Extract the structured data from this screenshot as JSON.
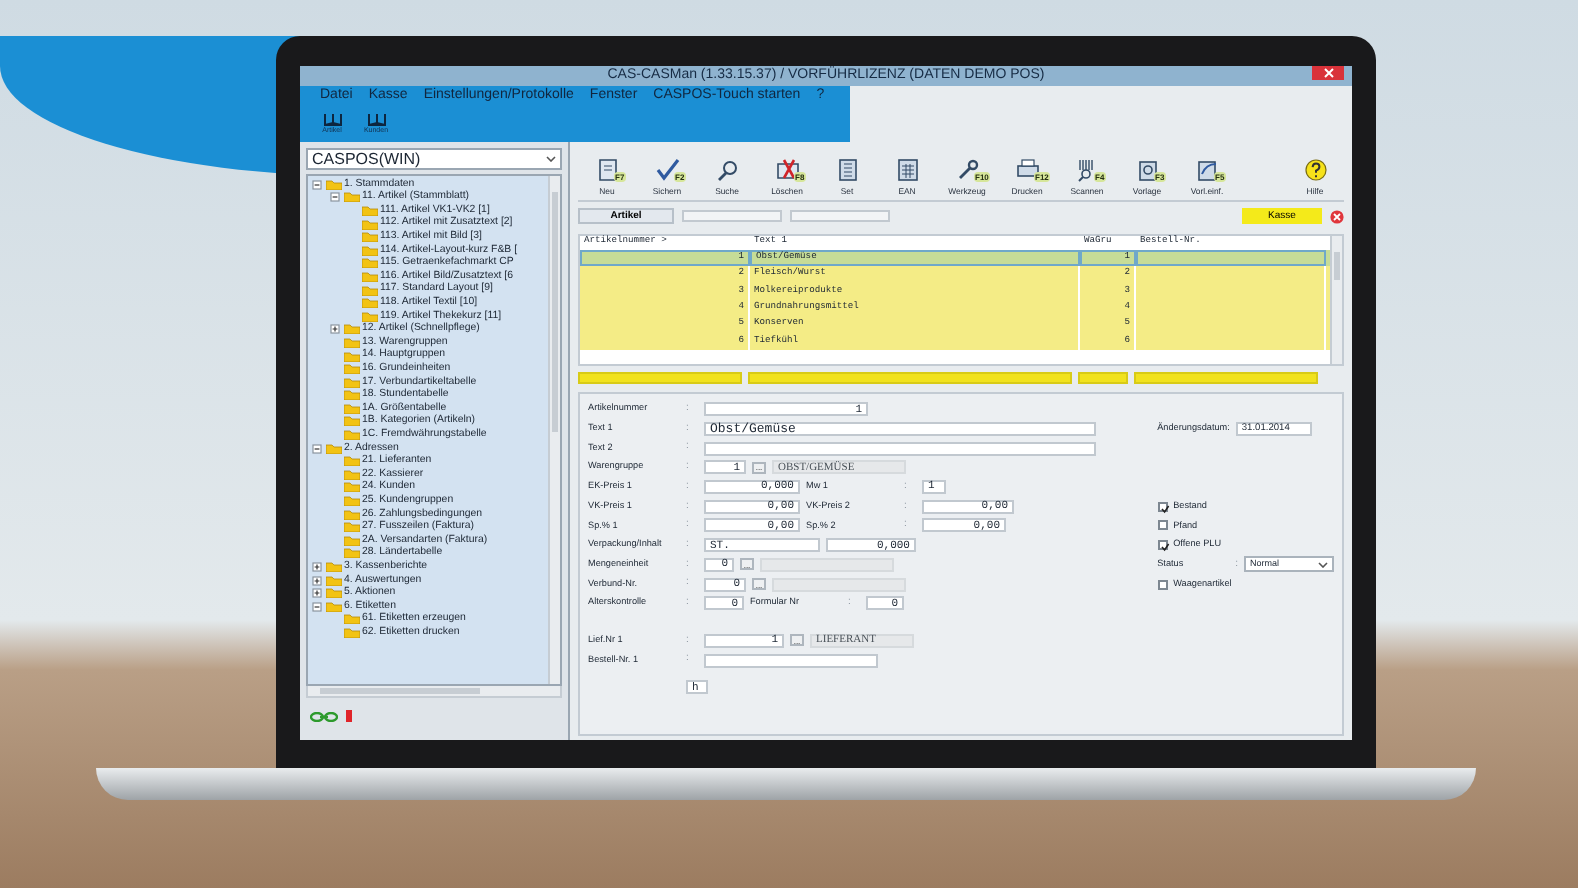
{
  "window": {
    "title": "CAS-CASMan (1.33.15.37) / VORFÜHRLIZENZ (DATEN DEMO POS)"
  },
  "menu": [
    "Datei",
    "Kasse",
    "Einstellungen/Protokolle",
    "Fenster",
    "CASPOS-Touch starten",
    "?"
  ],
  "quickbar": [
    {
      "label": "Artikel"
    },
    {
      "label": "Kunden"
    }
  ],
  "sidebar": {
    "selector": {
      "value": "CASPOS(WIN)"
    },
    "tree": [
      {
        "label": "1. Stammdaten",
        "expanded": true,
        "children": [
          {
            "label": "11. Artikel (Stammblatt)",
            "expanded": true,
            "children": [
              {
                "label": "111. Artikel VK1-VK2 [1]"
              },
              {
                "label": "112. Artikel mit Zusatztext [2]"
              },
              {
                "label": "113. Artikel mit Bild [3]"
              },
              {
                "label": "114. Artikel-Layout-kurz F&B ["
              },
              {
                "label": "115. Getraenkefachmarkt CP"
              },
              {
                "label": "116. Artikel Bild/Zusatztext [6"
              },
              {
                "label": "117. Standard Layout [9]"
              },
              {
                "label": "118. Artikel Textil [10]"
              },
              {
                "label": "119. Artikel Thekekurz [11]"
              }
            ]
          },
          {
            "label": "12. Artikel (Schnellpflege)",
            "expanded": false
          },
          {
            "label": "13. Warengruppen"
          },
          {
            "label": "14. Hauptgruppen"
          },
          {
            "label": "16. Grundeinheiten"
          },
          {
            "label": "17. Verbundartikeltabelle"
          },
          {
            "label": "18. Stundentabelle"
          },
          {
            "label": "1A. Größentabelle"
          },
          {
            "label": "1B. Kategorien (Artikeln)"
          },
          {
            "label": "1C. Fremdwährungstabelle"
          }
        ]
      },
      {
        "label": "2. Adressen",
        "expanded": true,
        "children": [
          {
            "label": "21. Lieferanten"
          },
          {
            "label": "22. Kassierer"
          },
          {
            "label": "24. Kunden"
          },
          {
            "label": "25. Kundengruppen"
          },
          {
            "label": "26. Zahlungsbedingungen"
          },
          {
            "label": "27. Fusszeilen (Faktura)"
          },
          {
            "label": "2A. Versandarten (Faktura)"
          },
          {
            "label": "28. Ländertabelle"
          }
        ]
      },
      {
        "label": "3. Kassenberichte",
        "expanded": false
      },
      {
        "label": "4. Auswertungen",
        "expanded": false
      },
      {
        "label": "5. Aktionen",
        "expanded": false
      },
      {
        "label": "6. Etiketten",
        "expanded": true,
        "children": [
          {
            "label": "61. Etiketten erzeugen"
          },
          {
            "label": "62. Etiketten drucken"
          }
        ]
      }
    ]
  },
  "toolbar": [
    {
      "label": "Neu",
      "key": "F7"
    },
    {
      "label": "Sichern",
      "key": "F2"
    },
    {
      "label": "Suche"
    },
    {
      "label": "Löschen",
      "key": "F8"
    },
    {
      "label": "Set"
    },
    {
      "label": "EAN"
    },
    {
      "label": "Werkzeug",
      "key": "F10"
    },
    {
      "label": "Drucken",
      "key": "F12"
    },
    {
      "label": "Scannen",
      "key": "F4"
    },
    {
      "label": "Vorlage",
      "key": "F3"
    },
    {
      "label": "Vorl.einf.",
      "key": "F5"
    },
    {
      "label": "Hilfe"
    }
  ],
  "tabbar": {
    "tab": {
      "label": "Artikel",
      "selected": true
    },
    "action": {
      "label": "Kasse"
    }
  },
  "table": {
    "columns": [
      "Artikelnummer >",
      "Text 1",
      "WaGru",
      "Bestell-Nr."
    ],
    "rows": [
      {
        "cells": [
          "1",
          "Obst/Gemüse",
          "1"
        ],
        "selected": true
      },
      {
        "cells": [
          "2",
          "Fleisch/Wurst",
          "2"
        ],
        "selected": false
      },
      {
        "cells": [
          "3",
          "Molkereiprodukte",
          "3"
        ],
        "selected": false
      },
      {
        "cells": [
          "4",
          "Grundnahrungsmittel",
          "4"
        ],
        "selected": false
      },
      {
        "cells": [
          "5",
          "Konserven",
          "5"
        ],
        "selected": false
      },
      {
        "cells": [
          "6",
          "Tiefkühl",
          "6"
        ],
        "selected": false
      }
    ]
  },
  "form": {
    "rows": [
      [
        {
          "kind": "label",
          "text": "Artikelnummer"
        },
        {
          "kind": "sep",
          "text": ":"
        },
        {
          "kind": "number",
          "value": "1"
        }
      ],
      [
        {
          "kind": "label",
          "text": "Text 1"
        },
        {
          "kind": "sep",
          "text": ":"
        },
        {
          "kind": "text",
          "value": "Obst/Gemüse"
        }
      ],
      [
        {
          "kind": "label",
          "text": "Text 2"
        },
        {
          "kind": "sep",
          "text": ":"
        },
        {
          "kind": "text"
        }
      ],
      [
        {
          "kind": "label",
          "text": "Warengruppe"
        },
        {
          "kind": "sep",
          "text": ":"
        },
        {
          "kind": "number",
          "value": "1"
        },
        {
          "kind": "dots",
          "text": "..."
        },
        {
          "kind": "lookup",
          "value": "OBST/GEMÜSE"
        }
      ],
      [
        {
          "kind": "label",
          "text": "EK-Preis 1"
        },
        {
          "kind": "sep",
          "text": ":"
        },
        {
          "kind": "number",
          "value": "0,000"
        },
        {
          "kind": "label",
          "text": "Mw 1"
        },
        {
          "kind": "sep",
          "text": ":"
        },
        {
          "kind": "text",
          "value": "1"
        }
      ],
      [
        {
          "kind": "label",
          "text": "VK-Preis 1"
        },
        {
          "kind": "sep",
          "text": ":"
        },
        {
          "kind": "number",
          "value": "0,00"
        },
        {
          "kind": "label",
          "text": "VK-Preis 2"
        },
        {
          "kind": "sep",
          "text": ":"
        },
        {
          "kind": "number",
          "value": "0,00"
        }
      ],
      [
        {
          "kind": "label",
          "text": "Sp.% 1"
        },
        {
          "kind": "sep",
          "text": ":"
        },
        {
          "kind": "number",
          "value": "0,00"
        },
        {
          "kind": "label",
          "text": "Sp.% 2"
        },
        {
          "kind": "sep",
          "text": ":"
        },
        {
          "kind": "number",
          "value": "0,00"
        }
      ],
      [
        {
          "kind": "label",
          "text": "Verpackung/Inhalt"
        },
        {
          "kind": "sep",
          "text": ":"
        },
        {
          "kind": "text",
          "value": "ST."
        },
        {
          "kind": "number",
          "value": "0,000"
        }
      ],
      [
        {
          "kind": "label",
          "text": "Mengeneinheit"
        },
        {
          "kind": "sep",
          "text": ":"
        },
        {
          "kind": "number",
          "value": "0"
        },
        {
          "kind": "dots",
          "text": "..."
        },
        {
          "kind": "lookup"
        }
      ],
      [
        {
          "kind": "label",
          "text": "Verbund-Nr."
        },
        {
          "kind": "sep",
          "text": ":"
        },
        {
          "kind": "number",
          "value": "0"
        },
        {
          "kind": "dots",
          "text": "..."
        },
        {
          "kind": "lookup"
        }
      ],
      [
        {
          "kind": "label",
          "text": "Alterskontrolle"
        },
        {
          "kind": "sep",
          "text": ":"
        },
        {
          "kind": "number",
          "value": "0"
        },
        {
          "kind": "label",
          "text": "Formular Nr"
        },
        {
          "kind": "sep",
          "text": ":"
        },
        {
          "kind": "number",
          "value": "0"
        }
      ],
      [
        {
          "kind": "label",
          "text": "Lief.Nr 1"
        },
        {
          "kind": "sep",
          "text": ":"
        },
        {
          "kind": "number",
          "value": "1"
        },
        {
          "kind": "dots",
          "text": "..."
        },
        {
          "kind": "lookup",
          "value": "LIEFERANT"
        }
      ],
      [
        {
          "kind": "label",
          "text": "Bestell-Nr. 1"
        },
        {
          "kind": "sep",
          "text": ":"
        },
        {
          "kind": "text"
        }
      ],
      [
        {
          "kind": "text",
          "value": "h"
        }
      ]
    ],
    "side": [
      {
        "kind": "date",
        "label": "Änderungsdatum:",
        "value": "31.01.2014"
      },
      {
        "kind": "checkbox",
        "label": "Bestand",
        "checked": true
      },
      {
        "kind": "checkbox",
        "label": "Pfand",
        "checked": false
      },
      {
        "kind": "checkbox",
        "label": "Offene PLU",
        "checked": true
      },
      {
        "kind": "select",
        "label": "Status",
        "sep": ":",
        "value": "Normal"
      },
      {
        "kind": "checkbox",
        "label": "Waagenartikel",
        "checked": false
      }
    ]
  }
}
